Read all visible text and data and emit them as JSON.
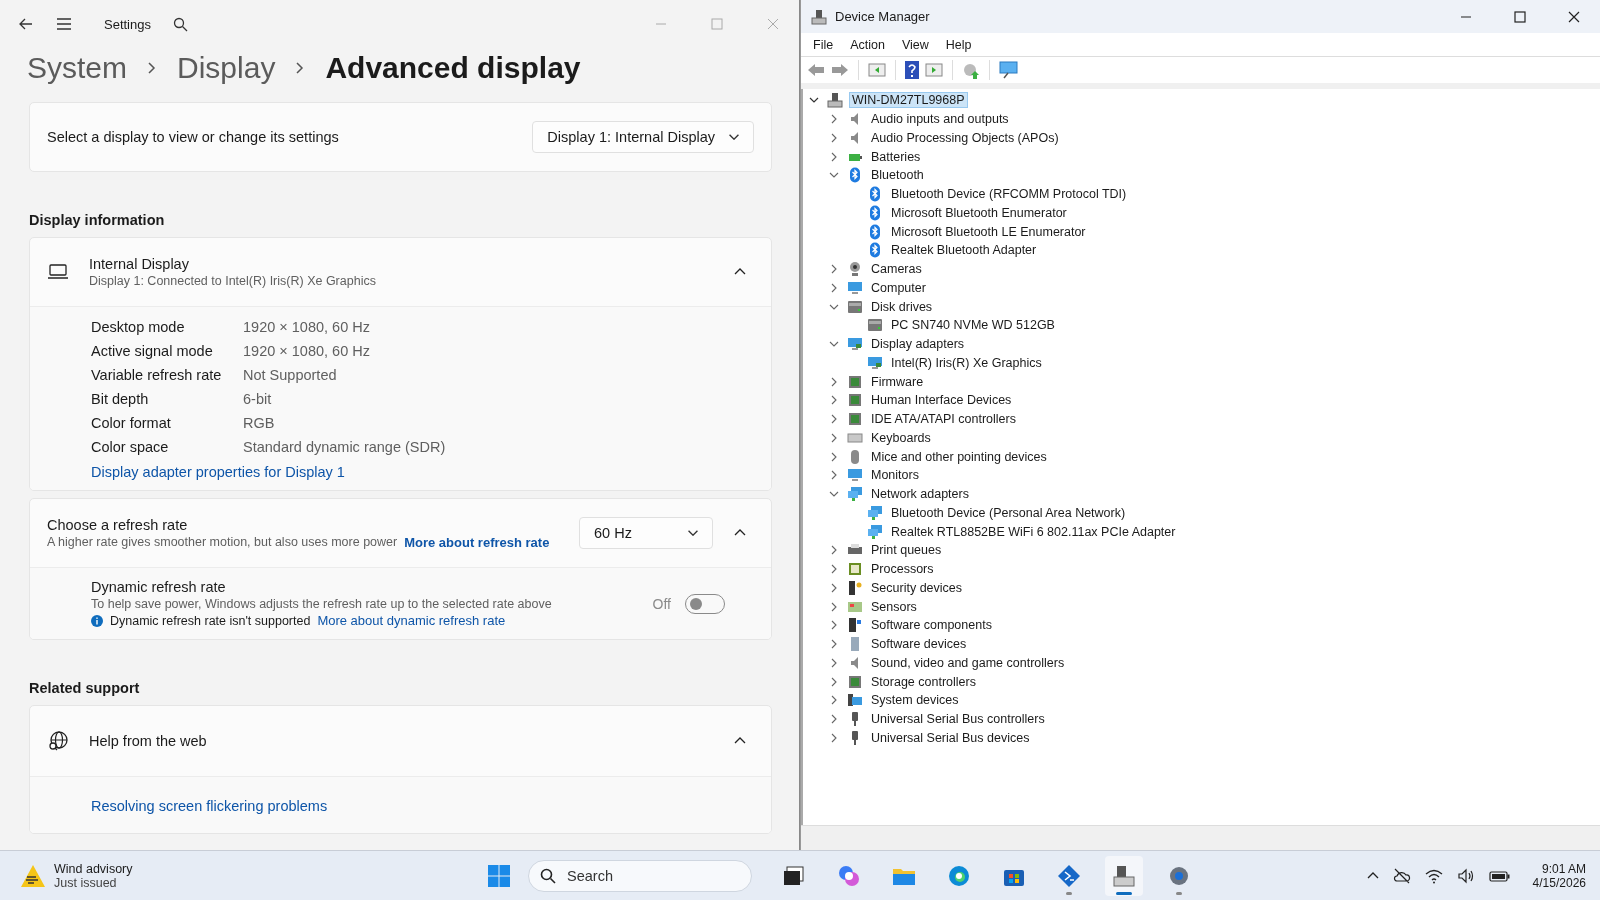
{
  "settings": {
    "title": "Settings",
    "breadcrumb": [
      "System",
      "Display",
      "Advanced display"
    ],
    "display_select": {
      "label": "Select a display to view or change its settings",
      "value": "Display 1: Internal Display"
    },
    "display_info": {
      "heading": "Display information",
      "device": {
        "name": "Internal Display",
        "description": "Display 1: Connected to Intel(R) Iris(R) Xe Graphics",
        "expanded": true
      },
      "properties": [
        {
          "label": "Desktop mode",
          "value": "1920 × 1080, 60 Hz"
        },
        {
          "label": "Active signal mode",
          "value": "1920 × 1080, 60 Hz"
        },
        {
          "label": "Variable refresh rate",
          "value": "Not Supported"
        },
        {
          "label": "Bit depth",
          "value": "6-bit"
        },
        {
          "label": "Color format",
          "value": "RGB"
        },
        {
          "label": "Color space",
          "value": "Standard dynamic range (SDR)"
        }
      ],
      "link": "Display adapter properties for Display 1"
    },
    "refresh": {
      "title": "Choose a refresh rate",
      "description": "A higher rate gives smoother motion, but also uses more power",
      "link": "More about refresh rate",
      "value": "60 Hz",
      "expanded": true,
      "dynamic": {
        "title": "Dynamic refresh rate",
        "description": "To help save power, Windows adjusts the refresh rate up to the selected rate above",
        "note": "Dynamic refresh rate isn't supported",
        "link": "More about dynamic refresh rate",
        "state_label": "Off",
        "on": false
      }
    },
    "related": {
      "heading": "Related support",
      "item": {
        "title": "Help from the web",
        "expanded": true
      },
      "link": "Resolving screen flickering problems"
    }
  },
  "device_manager": {
    "title": "Device Manager",
    "menu": [
      "File",
      "Action",
      "View",
      "Help"
    ],
    "root": {
      "name": "WIN-DM27TL9968P",
      "expanded": true,
      "selected": true
    },
    "categories": [
      {
        "name": "Audio inputs and outputs",
        "expanded": false
      },
      {
        "name": "Audio Processing Objects (APOs)",
        "expanded": false
      },
      {
        "name": "Batteries",
        "expanded": false
      },
      {
        "name": "Bluetooth",
        "expanded": true,
        "children": [
          "Bluetooth Device (RFCOMM Protocol TDI)",
          "Microsoft Bluetooth Enumerator",
          "Microsoft Bluetooth LE Enumerator",
          "Realtek Bluetooth Adapter"
        ]
      },
      {
        "name": "Cameras",
        "expanded": false
      },
      {
        "name": "Computer",
        "expanded": false
      },
      {
        "name": "Disk drives",
        "expanded": true,
        "children": [
          "PC SN740 NVMe WD 512GB"
        ]
      },
      {
        "name": "Display adapters",
        "expanded": true,
        "children": [
          "Intel(R) Iris(R) Xe Graphics"
        ]
      },
      {
        "name": "Firmware",
        "expanded": false
      },
      {
        "name": "Human Interface Devices",
        "expanded": false
      },
      {
        "name": "IDE ATA/ATAPI controllers",
        "expanded": false
      },
      {
        "name": "Keyboards",
        "expanded": false
      },
      {
        "name": "Mice and other pointing devices",
        "expanded": false
      },
      {
        "name": "Monitors",
        "expanded": false
      },
      {
        "name": "Network adapters",
        "expanded": true,
        "children": [
          "Bluetooth Device (Personal Area Network)",
          "Realtek RTL8852BE WiFi 6 802.11ax PCIe Adapter"
        ]
      },
      {
        "name": "Print queues",
        "expanded": false
      },
      {
        "name": "Processors",
        "expanded": false
      },
      {
        "name": "Security devices",
        "expanded": false
      },
      {
        "name": "Sensors",
        "expanded": false
      },
      {
        "name": "Software components",
        "expanded": false
      },
      {
        "name": "Software devices",
        "expanded": false
      },
      {
        "name": "Sound, video and game controllers",
        "expanded": false
      },
      {
        "name": "Storage controllers",
        "expanded": false
      },
      {
        "name": "System devices",
        "expanded": false
      },
      {
        "name": "Universal Serial Bus controllers",
        "expanded": false
      },
      {
        "name": "Universal Serial Bus devices",
        "expanded": false
      }
    ]
  },
  "taskbar": {
    "notification": {
      "title": "Wind advisory",
      "subtitle": "Just issued"
    },
    "search": {
      "placeholder": "Search"
    },
    "apps": [
      {
        "running": false,
        "active": false
      },
      {
        "running": false,
        "active": false
      },
      {
        "running": false,
        "active": false
      },
      {
        "running": false,
        "active": false
      },
      {
        "running": false,
        "active": false
      },
      {
        "running": true,
        "active": false
      },
      {
        "running": true,
        "active": true
      },
      {
        "running": true,
        "active": false
      }
    ],
    "clock": {
      "time": "9:01 AM",
      "date": "4/15/2026"
    }
  }
}
